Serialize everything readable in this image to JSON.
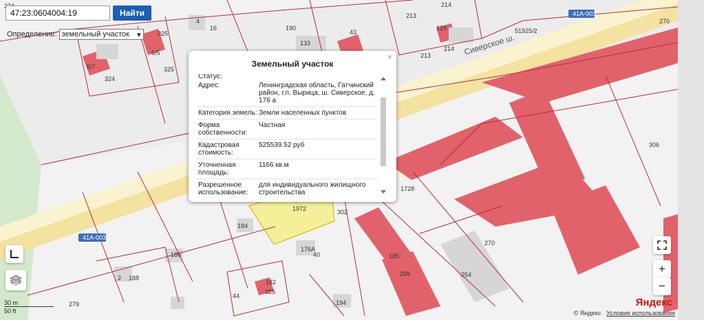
{
  "search": {
    "value": "47:23:0604004:19",
    "button": "Найти"
  },
  "definition": {
    "label": "Определение:",
    "selected": "земельный участок"
  },
  "road_labels": [
    "41А-003",
    "41А-003",
    "Сиверское ш."
  ],
  "cadastral_labels": [
    "27А",
    "4",
    "16",
    "325",
    "325",
    "6/7",
    "6/5",
    "324",
    "190",
    "133",
    "43",
    "129",
    "214",
    "213",
    "213",
    "214",
    "51925/2",
    "270",
    "1728",
    "306",
    "176А",
    "40",
    "184",
    "186",
    "188",
    "182",
    "325",
    "44",
    "194",
    "185",
    "299",
    "254",
    "270",
    "279",
    "1972",
    "302",
    "2"
  ],
  "popup": {
    "title": "Земельный участок",
    "cut_row": "Статус:",
    "rows": [
      {
        "key": "Адрес:",
        "value": "Ленинградская область, Гатчинский район, г.п. Вырица, ш. Сиверское, д. 176 а"
      },
      {
        "key": "Категория земель:",
        "value": "Земли населенных пунктов"
      },
      {
        "key": "Форма собственности:",
        "value": "Частная"
      },
      {
        "key": "Кадастровая стоимость:",
        "value": "525539.52 руб"
      },
      {
        "key": "Уточненная площадь:",
        "value": "1166 кв.м"
      },
      {
        "key": "Разрешенное использование:",
        "value": "для индивидуального жилищного строительства"
      }
    ]
  },
  "scale": {
    "metric": "30 m",
    "imperial": "50 ft"
  },
  "attribution": {
    "copyright": "© Яндекс",
    "terms": "Условия использования",
    "logo": "Яндекс"
  },
  "controls": {
    "zoom_in": "+",
    "zoom_out": "−"
  },
  "colors": {
    "building": "#e2626b",
    "road": "#f3e2a0",
    "parcel_line": "#b52e3c",
    "green": "#d4e8cc",
    "selected_parcel": "#f6ef9a"
  }
}
